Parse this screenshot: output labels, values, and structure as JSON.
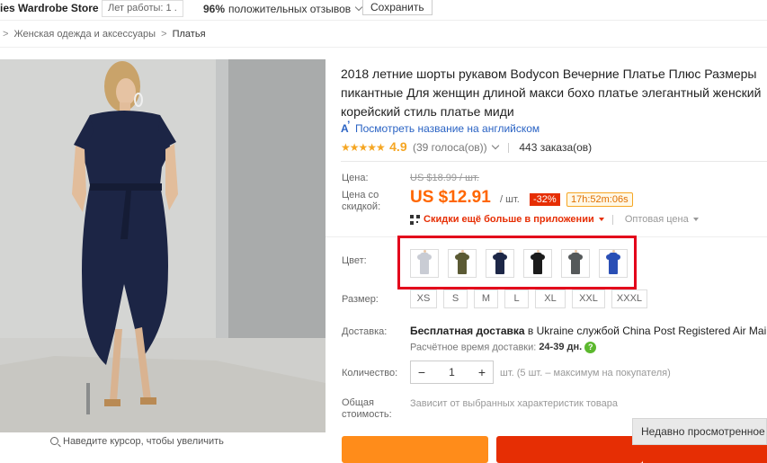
{
  "store_bar": {
    "store_name": "ies Wardrobe Store",
    "years_label": "Лет работы:",
    "years_value": "1 .",
    "positive_pct": "96%",
    "positive_label": "положительных отзывов",
    "save_label": "Сохранить"
  },
  "breadcrumb": {
    "items": [
      "Женская одежда и аксессуары",
      "Платья"
    ],
    "separator": ">"
  },
  "product": {
    "title": "2018 летние шорты рукавом Bodycon Вечерние Платье Плюс Размеры пикантные Для женщин длиной макси бохо платье элегантный женский корейский стиль платье миди",
    "translate_label": "Посмотреть название на английском",
    "rating_score": "4.9",
    "votes": "(39 голоса(ов))",
    "orders": "443 заказа(ов)",
    "zoom_hint": "Наведите курсор, чтобы увеличить"
  },
  "pricing": {
    "price_label": "Цена:",
    "old_price": "US $18.99 / шт.",
    "discount_price_label": "Цена со скидкой:",
    "new_price": "US $12.91",
    "per_unit": "/ шт.",
    "discount_badge": "-32%",
    "timer": "17h:52m:06s",
    "app_discount_link": "Скидки ещё больше в приложении",
    "wholesale_label": "Оптовая цена"
  },
  "options": {
    "color_label": "Цвет:",
    "colors": [
      {
        "name": "white",
        "hex": "#c9ccd4"
      },
      {
        "name": "olive",
        "hex": "#5b5a34"
      },
      {
        "name": "navy",
        "hex": "#1d2747"
      },
      {
        "name": "black",
        "hex": "#1b1b1b"
      },
      {
        "name": "gray",
        "hex": "#55595a"
      },
      {
        "name": "blue",
        "hex": "#2a4fb5"
      }
    ],
    "size_label": "Размер:",
    "sizes": [
      "XS",
      "S",
      "M",
      "L",
      "XL",
      "XXL",
      "XXXL"
    ]
  },
  "delivery": {
    "label": "Доставка:",
    "free_text": "Бесплатная доставка",
    "to_text": "в Ukraine службой China Post Registered Air Mail",
    "estimate_label": "Расчётное время доставки:",
    "estimate_days": "24-39 дн."
  },
  "quantity": {
    "label": "Количество:",
    "minus": "−",
    "value": "1",
    "plus": "+",
    "note": "шт. (5 шт. – максимум на покупателя)"
  },
  "total": {
    "label": "Общая стоимость:",
    "value": "Зависит от выбранных характеристик товара"
  },
  "recent": {
    "label": "Недавно просмотренное"
  },
  "colors": {
    "accent_orange": "#ff6600",
    "discount_red": "#e62e04",
    "highlight_red": "#e3001b",
    "link_blue": "#2a63c4",
    "star_yellow": "#f5a623"
  }
}
